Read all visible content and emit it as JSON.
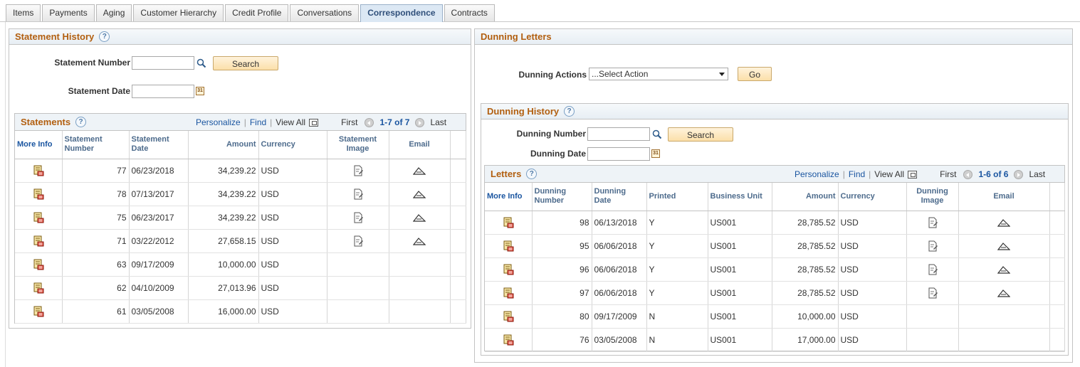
{
  "tabs": [
    "Items",
    "Payments",
    "Aging",
    "Customer Hierarchy",
    "Credit Profile",
    "Conversations",
    "Correspondence",
    "Contracts"
  ],
  "active_tab": "Correspondence",
  "statement_history": {
    "title": "Statement History",
    "statement_number_label": "Statement Number",
    "statement_date_label": "Statement Date",
    "search_label": "Search",
    "grid": {
      "title": "Statements",
      "personalize": "Personalize",
      "find": "Find",
      "view_all": "View All",
      "first": "First",
      "range": "1-7 of 7",
      "last": "Last",
      "headers": [
        "More Info",
        "Statement Number",
        "Statement Date",
        "Amount",
        "Currency",
        "Statement Image",
        "Email"
      ],
      "rows": [
        {
          "number": "77",
          "date": "06/23/2018",
          "amount": "34,239.22",
          "currency": "USD",
          "has_image": true
        },
        {
          "number": "78",
          "date": "07/13/2017",
          "amount": "34,239.22",
          "currency": "USD",
          "has_image": true
        },
        {
          "number": "75",
          "date": "06/23/2017",
          "amount": "34,239.22",
          "currency": "USD",
          "has_image": true
        },
        {
          "number": "71",
          "date": "03/22/2012",
          "amount": "27,658.15",
          "currency": "USD",
          "has_image": true
        },
        {
          "number": "63",
          "date": "09/17/2009",
          "amount": "10,000.00",
          "currency": "USD",
          "has_image": false
        },
        {
          "number": "62",
          "date": "04/10/2009",
          "amount": "27,013.96",
          "currency": "USD",
          "has_image": false
        },
        {
          "number": "61",
          "date": "03/05/2008",
          "amount": "16,000.00",
          "currency": "USD",
          "has_image": false
        }
      ]
    }
  },
  "dunning_letters": {
    "title": "Dunning Letters",
    "actions_label": "Dunning Actions",
    "actions_value": "...Select Action",
    "go_label": "Go",
    "history": {
      "title": "Dunning History",
      "number_label": "Dunning Number",
      "date_label": "Dunning Date",
      "search_label": "Search"
    },
    "grid": {
      "title": "Letters",
      "personalize": "Personalize",
      "find": "Find",
      "view_all": "View All",
      "first": "First",
      "range": "1-6 of 6",
      "last": "Last",
      "headers": [
        "More Info",
        "Dunning Number",
        "Dunning Date",
        "Printed",
        "Business Unit",
        "Amount",
        "Currency",
        "Dunning Image",
        "Email"
      ],
      "rows": [
        {
          "number": "98",
          "date": "06/13/2018",
          "printed": "Y",
          "unit": "US001",
          "amount": "28,785.52",
          "currency": "USD",
          "has_image": true
        },
        {
          "number": "95",
          "date": "06/06/2018",
          "printed": "Y",
          "unit": "US001",
          "amount": "28,785.52",
          "currency": "USD",
          "has_image": true
        },
        {
          "number": "96",
          "date": "06/06/2018",
          "printed": "Y",
          "unit": "US001",
          "amount": "28,785.52",
          "currency": "USD",
          "has_image": true
        },
        {
          "number": "97",
          "date": "06/06/2018",
          "printed": "Y",
          "unit": "US001",
          "amount": "28,785.52",
          "currency": "USD",
          "has_image": true
        },
        {
          "number": "80",
          "date": "09/17/2009",
          "printed": "N",
          "unit": "US001",
          "amount": "10,000.00",
          "currency": "USD",
          "has_image": false
        },
        {
          "number": "76",
          "date": "03/05/2008",
          "printed": "N",
          "unit": "US001",
          "amount": "17,000.00",
          "currency": "USD",
          "has_image": false
        }
      ]
    }
  }
}
